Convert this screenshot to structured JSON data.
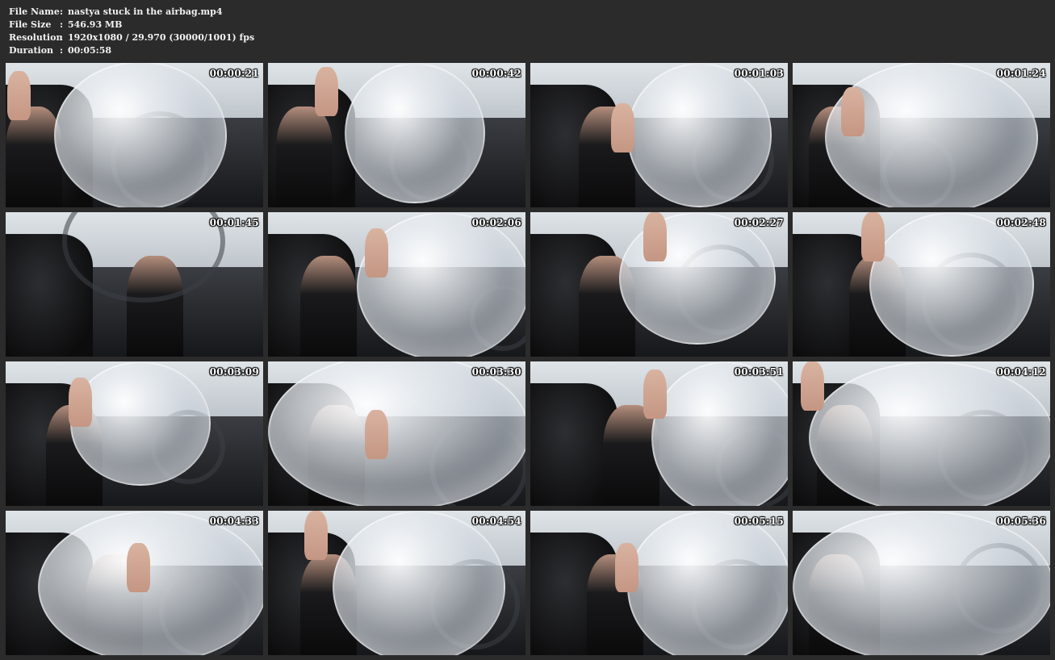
{
  "header": {
    "file_name_label": "File Name",
    "file_name_value": "nastya stuck in the airbag.mp4",
    "file_size_label": "File Size",
    "file_size_value": "546.93 MB",
    "resolution_label": "Resolution",
    "resolution_value": "1920x1080 / 29.970 (30000/1001) fps",
    "duration_label": "Duration",
    "duration_value": "00:05:58",
    "separator": ":"
  },
  "thumbnails": [
    {
      "timestamp": "00:00:21"
    },
    {
      "timestamp": "00:00:42"
    },
    {
      "timestamp": "00:01:03"
    },
    {
      "timestamp": "00:01:24"
    },
    {
      "timestamp": "00:01:45"
    },
    {
      "timestamp": "00:02:06"
    },
    {
      "timestamp": "00:02:27"
    },
    {
      "timestamp": "00:02:48"
    },
    {
      "timestamp": "00:03:09"
    },
    {
      "timestamp": "00:03:30"
    },
    {
      "timestamp": "00:03:51"
    },
    {
      "timestamp": "00:04:12"
    },
    {
      "timestamp": "00:04:33"
    },
    {
      "timestamp": "00:04:54"
    },
    {
      "timestamp": "00:05:15"
    },
    {
      "timestamp": "00:05:36"
    }
  ]
}
